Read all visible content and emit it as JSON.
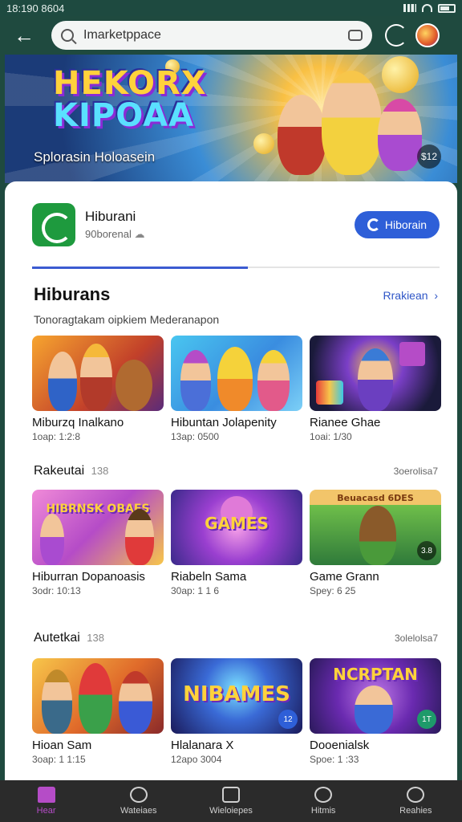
{
  "status_bar": {
    "time": "18:190 8604"
  },
  "search": {
    "value": "Imarketppace"
  },
  "hero": {
    "logo_line1": "HEKORX",
    "logo_line2": "KIPOAA",
    "subtitle": "Splorasin Holoasein",
    "badge": "$12"
  },
  "app": {
    "name": "Hiburani",
    "subtitle": "90borenal",
    "open_label": "Hiborain",
    "progress_percent": 53
  },
  "featured": {
    "title": "Hiburans",
    "link": "Rrakiean",
    "description": "Tonoragtakam oipkiem Mederanapon",
    "items": [
      {
        "title": "Miburzq Inalkano",
        "sub": "1oap: 1:2:8"
      },
      {
        "title": "Hibuntan Jolapenity",
        "sub": "13ap: 0500"
      },
      {
        "title": "Rianee Ghae",
        "sub": "1oai: 1/30"
      }
    ]
  },
  "row2": {
    "title": "Rakeutai",
    "count": "138",
    "link": "3oerolisa7",
    "items": [
      {
        "title": "Hiburran Dopanoasis",
        "sub": "3odr: 10:13",
        "art": "HIBRNSK OBAES"
      },
      {
        "title": "Riabeln Sama",
        "sub": "30ap: 1 1 6",
        "art": "GAMES"
      },
      {
        "title": "Game Grann",
        "sub": "Spey: 6 25",
        "art": "Beuacasd 6DES",
        "badge": "3.8"
      }
    ]
  },
  "row3": {
    "title": "Autetkai",
    "count": "138",
    "link": "3olelolsa7",
    "items": [
      {
        "title": "Hioan Sam",
        "sub": "3oap: 1 1:15"
      },
      {
        "title": "Hlalanara X",
        "sub": "12apo 3004",
        "art": "NIBAMES",
        "badge": "12"
      },
      {
        "title": "Dooenialsk",
        "sub": "Spoe: 1 :33",
        "art": "NCRPTAN",
        "badge": "1T"
      }
    ]
  },
  "bottom_nav": [
    {
      "label": "Hear",
      "icon": "home-icon",
      "active": true
    },
    {
      "label": "Wateiaes",
      "icon": "headset-icon"
    },
    {
      "label": "Wieloiepes",
      "icon": "tablet-icon"
    },
    {
      "label": "Hitmis",
      "icon": "compass-icon"
    },
    {
      "label": "Reahies",
      "icon": "person-icon"
    }
  ],
  "colors": {
    "top_bar": "#1f4a3f",
    "accent_blue": "#2e5fd8",
    "nav_active": "#b54cc7",
    "app_icon": "#1e9a3e"
  }
}
